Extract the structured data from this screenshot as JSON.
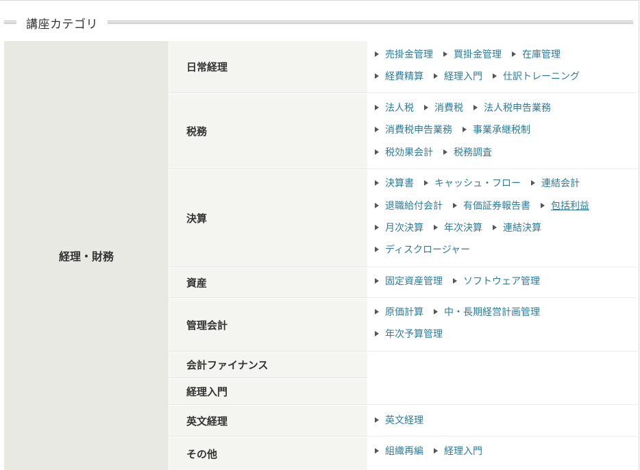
{
  "section_title": "講座カテゴリ",
  "main_category": "経理・財務",
  "rows": [
    {
      "label": "日常経理",
      "lines": [
        [
          "売掛金管理",
          "買掛金管理",
          "在庫管理"
        ],
        [
          "経費精算",
          "経理入門",
          "仕訳トレーニング"
        ]
      ]
    },
    {
      "label": "税務",
      "lines": [
        [
          "法人税",
          "消費税",
          "法人税申告業務"
        ],
        [
          "消費税申告業務",
          "事業承継税制"
        ],
        [
          "税効果会計",
          "税務調査"
        ]
      ]
    },
    {
      "label": "決算",
      "lines": [
        [
          "決算書",
          "キャッシュ・フロー",
          "連結会計"
        ],
        [
          "退職給付会計",
          "有価証券報告書",
          "包括利益"
        ],
        [
          "月次決算",
          "年次決算",
          "連結決算"
        ],
        [
          "ディスクロージャー"
        ]
      ]
    },
    {
      "label": "資産",
      "lines": [
        [
          "固定資産管理",
          "ソフトウェア管理"
        ]
      ]
    },
    {
      "label": "管理会計",
      "lines": [
        [
          "原価計算",
          "中・長期経営計画管理"
        ],
        [
          "年次予算管理"
        ]
      ]
    },
    {
      "label": "会計ファイナンス",
      "lines": []
    },
    {
      "label": "経理入門",
      "lines": []
    },
    {
      "label": "英文経理",
      "lines": [
        [
          "英文経理"
        ]
      ]
    },
    {
      "label": "その他",
      "lines": [
        [
          "組織再編",
          "経理入門"
        ]
      ]
    }
  ]
}
